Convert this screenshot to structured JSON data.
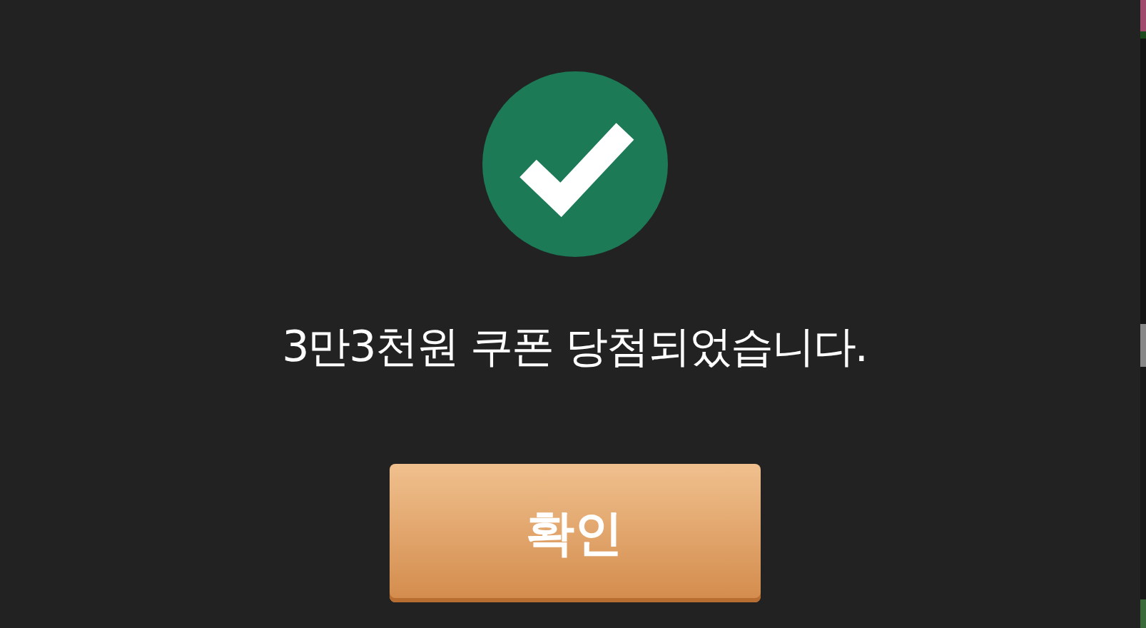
{
  "dialog": {
    "message": "3만3천원 쿠폰 당첨되었습니다.",
    "confirm_button": "확인"
  }
}
